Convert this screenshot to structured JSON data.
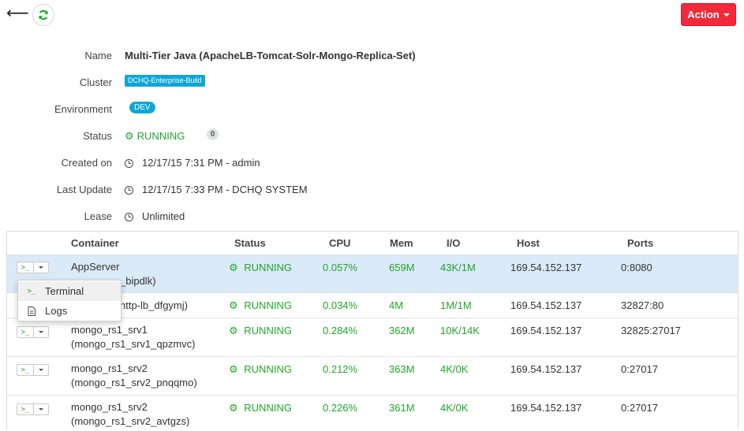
{
  "toolbar": {
    "action_label": "Action"
  },
  "details": {
    "name_label": "Name",
    "name_value": "Multi-Tier Java (ApacheLB-Tomcat-Solr-Mongo-Replica-Set)",
    "cluster_label": "Cluster",
    "cluster_value": "DCHQ-Enterprise-Build",
    "environment_label": "Environment",
    "environment_value": "DEV",
    "status_label": "Status",
    "status_value": "RUNNING",
    "status_count": "0",
    "created_label": "Created on",
    "created_value": "12/17/15 7:31 PM - admin",
    "update_label": "Last Update",
    "update_value": "12/17/15 7:33 PM - DCHQ SYSTEM",
    "lease_label": "Lease",
    "lease_value": "Unlimited"
  },
  "table": {
    "headers": {
      "container": "Container",
      "status": "Status",
      "cpu": "CPU",
      "mem": "Mem",
      "io": "I/O",
      "host": "Host",
      "ports": "Ports"
    },
    "rows": [
      {
        "name": "AppServer",
        "sub": "_bipdlk)",
        "status": "RUNNING",
        "cpu": "0.057%",
        "mem": "659M",
        "io": "43K/1M",
        "host": "169.54.152.137",
        "ports": "0:8080"
      },
      {
        "name": "",
        "sub": "http-lb_dfgymj)",
        "status": "RUNNING",
        "cpu": "0.034%",
        "mem": "4M",
        "io": "1M/1M",
        "host": "169.54.152.137",
        "ports": "32827:80"
      },
      {
        "name": "mongo_rs1_srv1",
        "sub": "(mongo_rs1_srv1_qpzmvc)",
        "status": "RUNNING",
        "cpu": "0.284%",
        "mem": "362M",
        "io": "10K/14K",
        "host": "169.54.152.137",
        "ports": "32825:27017"
      },
      {
        "name": "mongo_rs1_srv2",
        "sub": "(mongo_rs1_srv2_pnqqmo)",
        "status": "RUNNING",
        "cpu": "0.212%",
        "mem": "363M",
        "io": "4K/0K",
        "host": "169.54.152.137",
        "ports": "0:27017"
      },
      {
        "name": "mongo_rs1_srv2",
        "sub": "(mongo_rs1_srv2_avtgzs)",
        "status": "RUNNING",
        "cpu": "0.226%",
        "mem": "361M",
        "io": "4K/0K",
        "host": "169.54.152.137",
        "ports": "0:27017"
      }
    ]
  },
  "menu": {
    "terminal_label": "Terminal",
    "logs_label": "Logs"
  },
  "icons": {
    "terminal": ">_"
  },
  "colors": {
    "accent": "#f2293a",
    "running": "#1fa628",
    "badge": "#0fa6d6",
    "selected_row": "#dbeaf8"
  }
}
